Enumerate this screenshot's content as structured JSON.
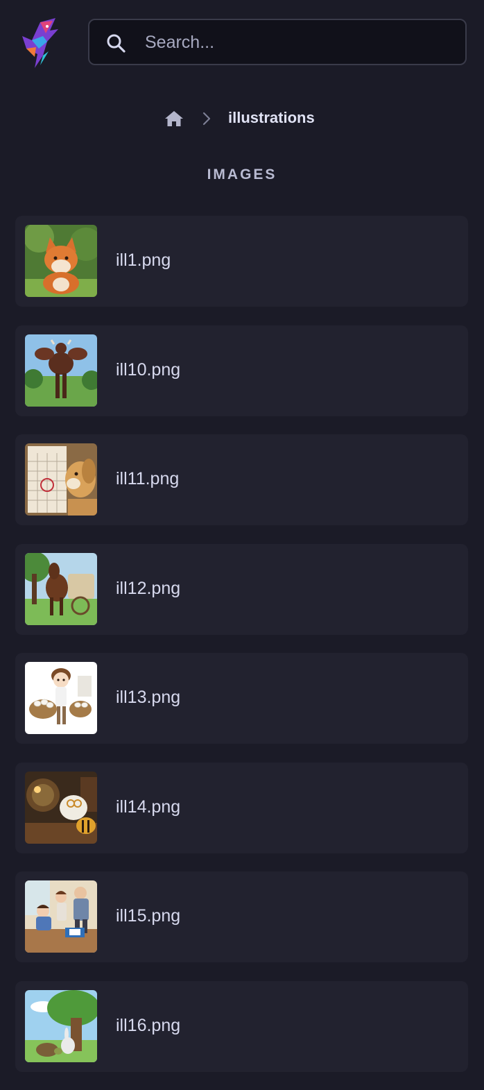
{
  "search": {
    "placeholder": "Search..."
  },
  "breadcrumb": {
    "current": "illustrations"
  },
  "section": {
    "title": "IMAGES"
  },
  "files": [
    {
      "name": "ill1.png"
    },
    {
      "name": "ill10.png"
    },
    {
      "name": "ill11.png"
    },
    {
      "name": "ill12.png"
    },
    {
      "name": "ill13.png"
    },
    {
      "name": "ill14.png"
    },
    {
      "name": "ill15.png"
    },
    {
      "name": "ill16.png"
    }
  ],
  "colors": {
    "background": "#1b1b27",
    "card": "#22222f",
    "text": "#d7d9ee",
    "muted": "#a7a9c0"
  }
}
